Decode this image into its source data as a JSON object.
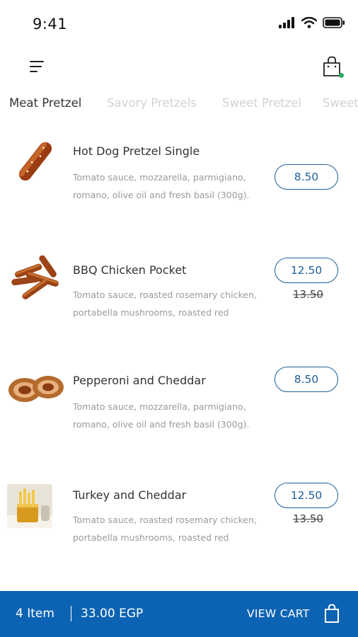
{
  "status": {
    "time": "9:41"
  },
  "tabs": [
    "Meat Pretzel",
    "Savory Pretzels",
    "Sweet Pretzel",
    "Sweet"
  ],
  "items": [
    {
      "name": "Hot Dog Pretzel Single",
      "desc_line1": "Tomato sauce, mozzarella, parmigiano,",
      "desc_line2": "romano, olive oil and fresh basil (300g).",
      "price": "8.50",
      "old_price": ""
    },
    {
      "name": "BBQ Chicken Pocket",
      "desc_line1": "Tomato sauce, roasted rosemary chicken,",
      "desc_line2": "portabella mushrooms, roasted red",
      "price": "12.50",
      "old_price": "13.50"
    },
    {
      "name": "Pepperoni and Cheddar",
      "desc_line1": "Tomato sauce, mozzarella, parmigiano,",
      "desc_line2": "romano, olive oil and fresh basil (300g).",
      "price": "8.50",
      "old_price": ""
    },
    {
      "name": "Turkey and Cheddar",
      "desc_line1": "Tomato sauce, roasted rosemary chicken,",
      "desc_line2": "portabella mushrooms, roasted red",
      "price": "12.50",
      "old_price": "13.50"
    }
  ],
  "cart_bar": {
    "count": "4 Item",
    "total": "33.00 EGP",
    "view_label": "VIEW CART"
  },
  "colors": {
    "accent": "#0d63b3",
    "price_border": "#1f5f99",
    "cart_dot": "#27ae60"
  },
  "icons": [
    "signal-icon",
    "wifi-icon",
    "battery-icon",
    "menu-icon",
    "shopping-bag-icon"
  ]
}
